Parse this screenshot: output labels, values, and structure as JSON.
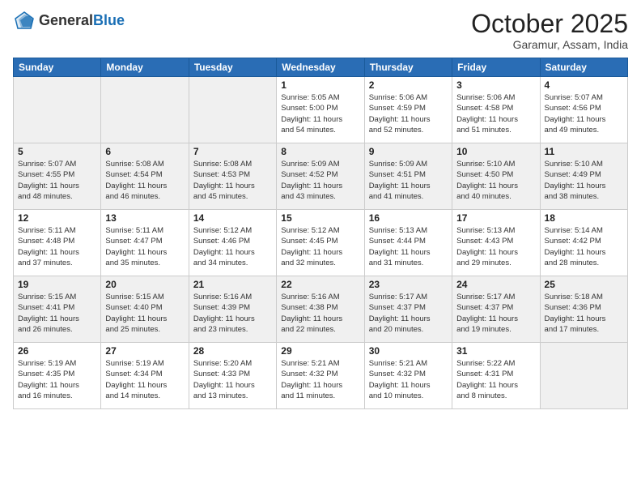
{
  "header": {
    "logo_general": "General",
    "logo_blue": "Blue",
    "month_title": "October 2025",
    "subtitle": "Garamur, Assam, India"
  },
  "weekdays": [
    "Sunday",
    "Monday",
    "Tuesday",
    "Wednesday",
    "Thursday",
    "Friday",
    "Saturday"
  ],
  "rows": [
    [
      {
        "day": "",
        "info": ""
      },
      {
        "day": "",
        "info": ""
      },
      {
        "day": "",
        "info": ""
      },
      {
        "day": "1",
        "info": "Sunrise: 5:05 AM\nSunset: 5:00 PM\nDaylight: 11 hours\nand 54 minutes."
      },
      {
        "day": "2",
        "info": "Sunrise: 5:06 AM\nSunset: 4:59 PM\nDaylight: 11 hours\nand 52 minutes."
      },
      {
        "day": "3",
        "info": "Sunrise: 5:06 AM\nSunset: 4:58 PM\nDaylight: 11 hours\nand 51 minutes."
      },
      {
        "day": "4",
        "info": "Sunrise: 5:07 AM\nSunset: 4:56 PM\nDaylight: 11 hours\nand 49 minutes."
      }
    ],
    [
      {
        "day": "5",
        "info": "Sunrise: 5:07 AM\nSunset: 4:55 PM\nDaylight: 11 hours\nand 48 minutes."
      },
      {
        "day": "6",
        "info": "Sunrise: 5:08 AM\nSunset: 4:54 PM\nDaylight: 11 hours\nand 46 minutes."
      },
      {
        "day": "7",
        "info": "Sunrise: 5:08 AM\nSunset: 4:53 PM\nDaylight: 11 hours\nand 45 minutes."
      },
      {
        "day": "8",
        "info": "Sunrise: 5:09 AM\nSunset: 4:52 PM\nDaylight: 11 hours\nand 43 minutes."
      },
      {
        "day": "9",
        "info": "Sunrise: 5:09 AM\nSunset: 4:51 PM\nDaylight: 11 hours\nand 41 minutes."
      },
      {
        "day": "10",
        "info": "Sunrise: 5:10 AM\nSunset: 4:50 PM\nDaylight: 11 hours\nand 40 minutes."
      },
      {
        "day": "11",
        "info": "Sunrise: 5:10 AM\nSunset: 4:49 PM\nDaylight: 11 hours\nand 38 minutes."
      }
    ],
    [
      {
        "day": "12",
        "info": "Sunrise: 5:11 AM\nSunset: 4:48 PM\nDaylight: 11 hours\nand 37 minutes."
      },
      {
        "day": "13",
        "info": "Sunrise: 5:11 AM\nSunset: 4:47 PM\nDaylight: 11 hours\nand 35 minutes."
      },
      {
        "day": "14",
        "info": "Sunrise: 5:12 AM\nSunset: 4:46 PM\nDaylight: 11 hours\nand 34 minutes."
      },
      {
        "day": "15",
        "info": "Sunrise: 5:12 AM\nSunset: 4:45 PM\nDaylight: 11 hours\nand 32 minutes."
      },
      {
        "day": "16",
        "info": "Sunrise: 5:13 AM\nSunset: 4:44 PM\nDaylight: 11 hours\nand 31 minutes."
      },
      {
        "day": "17",
        "info": "Sunrise: 5:13 AM\nSunset: 4:43 PM\nDaylight: 11 hours\nand 29 minutes."
      },
      {
        "day": "18",
        "info": "Sunrise: 5:14 AM\nSunset: 4:42 PM\nDaylight: 11 hours\nand 28 minutes."
      }
    ],
    [
      {
        "day": "19",
        "info": "Sunrise: 5:15 AM\nSunset: 4:41 PM\nDaylight: 11 hours\nand 26 minutes."
      },
      {
        "day": "20",
        "info": "Sunrise: 5:15 AM\nSunset: 4:40 PM\nDaylight: 11 hours\nand 25 minutes."
      },
      {
        "day": "21",
        "info": "Sunrise: 5:16 AM\nSunset: 4:39 PM\nDaylight: 11 hours\nand 23 minutes."
      },
      {
        "day": "22",
        "info": "Sunrise: 5:16 AM\nSunset: 4:38 PM\nDaylight: 11 hours\nand 22 minutes."
      },
      {
        "day": "23",
        "info": "Sunrise: 5:17 AM\nSunset: 4:37 PM\nDaylight: 11 hours\nand 20 minutes."
      },
      {
        "day": "24",
        "info": "Sunrise: 5:17 AM\nSunset: 4:37 PM\nDaylight: 11 hours\nand 19 minutes."
      },
      {
        "day": "25",
        "info": "Sunrise: 5:18 AM\nSunset: 4:36 PM\nDaylight: 11 hours\nand 17 minutes."
      }
    ],
    [
      {
        "day": "26",
        "info": "Sunrise: 5:19 AM\nSunset: 4:35 PM\nDaylight: 11 hours\nand 16 minutes."
      },
      {
        "day": "27",
        "info": "Sunrise: 5:19 AM\nSunset: 4:34 PM\nDaylight: 11 hours\nand 14 minutes."
      },
      {
        "day": "28",
        "info": "Sunrise: 5:20 AM\nSunset: 4:33 PM\nDaylight: 11 hours\nand 13 minutes."
      },
      {
        "day": "29",
        "info": "Sunrise: 5:21 AM\nSunset: 4:32 PM\nDaylight: 11 hours\nand 11 minutes."
      },
      {
        "day": "30",
        "info": "Sunrise: 5:21 AM\nSunset: 4:32 PM\nDaylight: 11 hours\nand 10 minutes."
      },
      {
        "day": "31",
        "info": "Sunrise: 5:22 AM\nSunset: 4:31 PM\nDaylight: 11 hours\nand 8 minutes."
      },
      {
        "day": "",
        "info": ""
      }
    ]
  ]
}
